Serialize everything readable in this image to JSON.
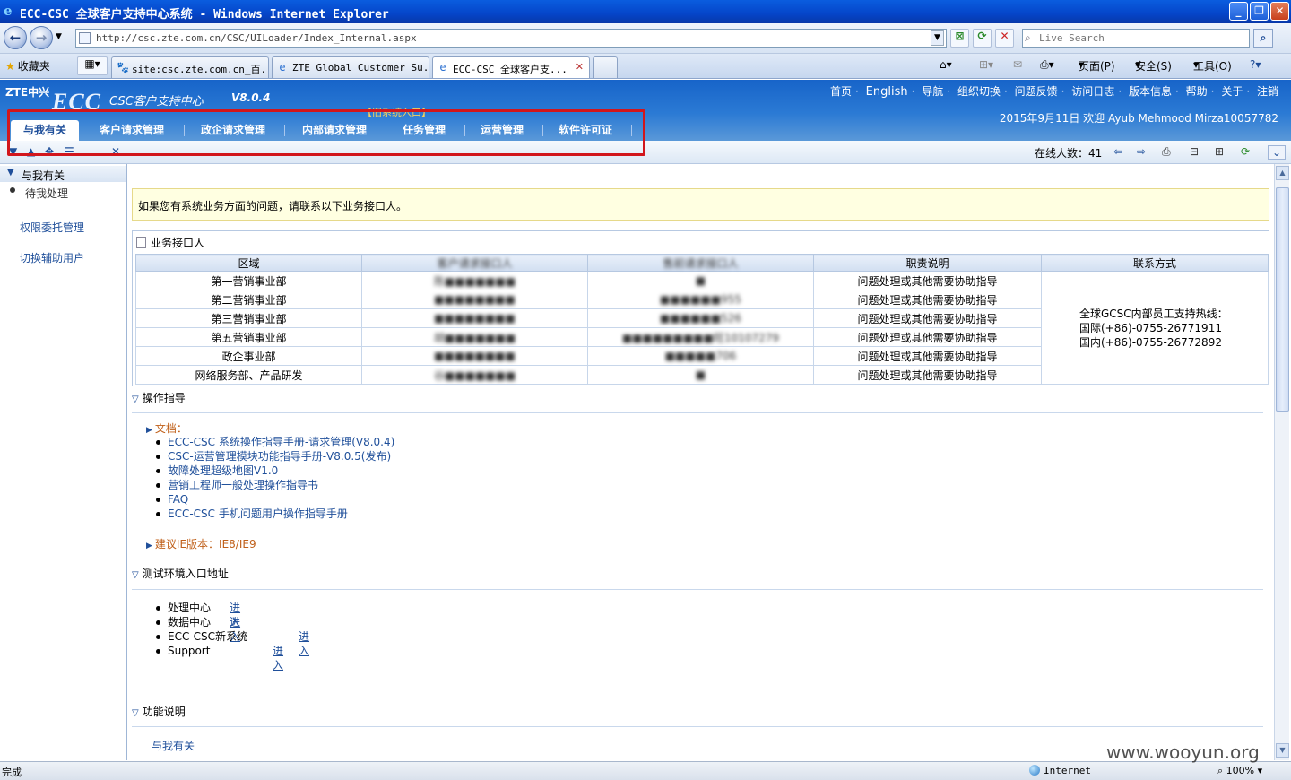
{
  "window": {
    "title": "ECC-CSC 全球客户支持中心系统 - Windows Internet Explorer",
    "min": "_",
    "max": "❐",
    "close": "✕"
  },
  "address": {
    "url": "http://csc.zte.com.cn/CSC/UILoader/Index_Internal.aspx",
    "search_placeholder": "Live Search"
  },
  "favorites_label": "收藏夹",
  "tabs": [
    {
      "label": "site:csc.zte.com.cn_百..."
    },
    {
      "label": "ZTE Global Customer Su..."
    },
    {
      "label": "ECC-CSC 全球客户支..."
    }
  ],
  "command_bar": {
    "page": "页面(P)",
    "safety": "安全(S)",
    "tools": "工具(O)"
  },
  "header": {
    "logo": "ZTE中兴",
    "brand": "ECC",
    "system_name": "CSC客户支持中心",
    "version": "V8.0.4",
    "old_entry": "【旧系统入口】",
    "links": [
      "首页",
      "English",
      "导航",
      "组织切换",
      "问题反馈",
      "访问日志",
      "版本信息",
      "帮助",
      "关于",
      "注销"
    ],
    "welcome": "2015年9月11日 欢迎 Ayub Mehmood Mirza10057782"
  },
  "menu": [
    {
      "label": "与我有关"
    },
    {
      "label": "客户请求管理"
    },
    {
      "label": "政企请求管理"
    },
    {
      "label": "内部请求管理"
    },
    {
      "label": "任务管理"
    },
    {
      "label": "运营管理"
    },
    {
      "label": "软件许可证"
    }
  ],
  "online": "在线人数：41",
  "sidebar": {
    "section": "与我有关",
    "items": [
      "待我处理"
    ],
    "links": [
      "权限委托管理",
      "切换辅助用户"
    ]
  },
  "notice": "如果您有系统业务方面的问题，请联系以下业务接口人。",
  "contacts": {
    "caption": "业务接口人",
    "headers": [
      "区域",
      "客户请求接口人",
      "售前请求接口人",
      "职责说明",
      "联系方式"
    ],
    "rows": [
      {
        "region": "第一营销事业部",
        "p1": "陈■■■■■■■",
        "p2": "■",
        "duty": "问题处理或其他需要协助指导"
      },
      {
        "region": "第二营销事业部",
        "p1": "■■■■■■■■",
        "p2": "■■■■■■955",
        "duty": "问题处理或其他需要协助指导"
      },
      {
        "region": "第三营销事业部",
        "p1": "■■■■■■■■",
        "p2": "■■■■■■526",
        "duty": "问题处理或其他需要协助指导"
      },
      {
        "region": "第五营销事业部",
        "p1": "胡■■■■■■■",
        "p2": "■■■■■■■■■旺10107279",
        "duty": "问题处理或其他需要协助指导"
      },
      {
        "region": "政企事业部",
        "p1": "■■■■■■■■",
        "p2": "■■■■■706",
        "duty": "问题处理或其他需要协助指导"
      },
      {
        "region": "网络服务部、产品研发",
        "p1": "谷■■■■■■■",
        "p2": "■",
        "duty": "问题处理或其他需要协助指导"
      }
    ],
    "contact_lines": [
      "全球GCSC内部员工支持热线：",
      "国际(+86)-0755-26771911",
      "国内(+86)-0755-26772892"
    ]
  },
  "guide": {
    "title": "操作指导",
    "docs_label": "文档：",
    "docs": [
      "ECC-CSC 系统操作指导手册-请求管理(V8.0.4)",
      "CSC-运营管理模块功能指导手册-V8.0.5(发布)",
      "故障处理超级地图V1.0",
      "营销工程师一般处理操作指导书",
      "FAQ",
      "ECC-CSC 手机问题用户操作指导手册"
    ],
    "ie_label": "建议IE版本：IE8/IE9"
  },
  "env": {
    "title": "测试环境入口地址",
    "items": [
      {
        "name": "处理中心",
        "go": "进入"
      },
      {
        "name": "数据中心",
        "go": "进入"
      },
      {
        "name": "ECC-CSC新系统",
        "go": "进入"
      },
      {
        "name": "Support",
        "go": "进入"
      }
    ]
  },
  "func": {
    "title": "功能说明",
    "link": "与我有关"
  },
  "status": {
    "done": "完成",
    "zone": "Internet",
    "zoom": "100%"
  },
  "watermark": "www.wooyun.org",
  "colors": {
    "header_blue": "#1764c9",
    "highlight_red": "#d2161c",
    "link_blue": "#1f4f9a"
  }
}
